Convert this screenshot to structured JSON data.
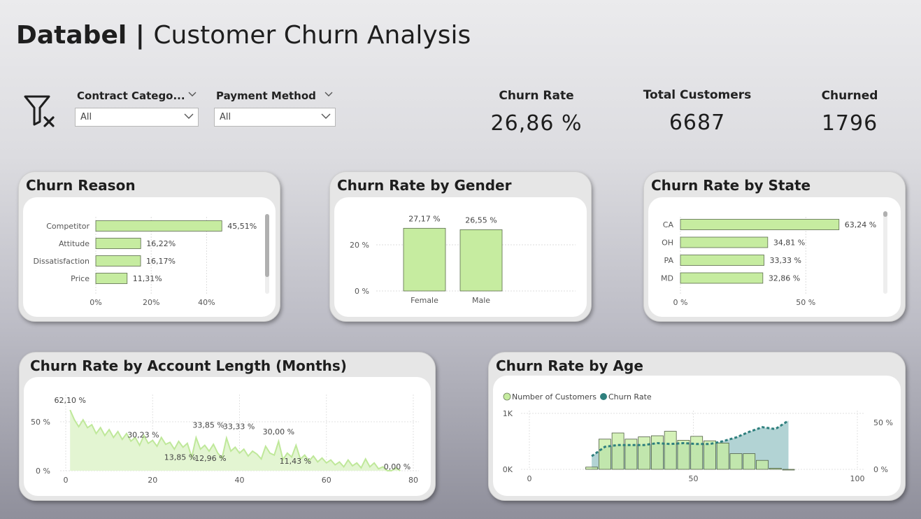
{
  "header": {
    "brand": "Databel | ",
    "title": "Customer Churn Analysis"
  },
  "filters": [
    {
      "label": "Contract Catego...",
      "value": "All"
    },
    {
      "label": "Payment Method",
      "value": "All"
    }
  ],
  "kpis": [
    {
      "label": "Churn Rate",
      "value": "26,86 %"
    },
    {
      "label": "Total Customers",
      "value": "6687"
    },
    {
      "label": "Churned",
      "value": "1796"
    }
  ],
  "colors": {
    "bar": "#c6eca0",
    "bar_stroke": "#5a6b4c",
    "area": "#e3f5d2",
    "line": "#bfe89a",
    "age_bar": "#8fc99a",
    "teal": "#2e7f7d",
    "teal_area": "#a5cbcc"
  },
  "chart_data": [
    {
      "id": "churn_reason",
      "type": "bar",
      "orientation": "horizontal",
      "title": "Churn Reason",
      "categories": [
        "Competitor",
        "Attitude",
        "Dissatisfaction",
        "Price"
      ],
      "values": [
        45.51,
        16.22,
        16.17,
        11.31
      ],
      "labels": [
        "45,51%",
        "16,22%",
        "16,17%",
        "11,31%"
      ],
      "xlim": [
        0,
        50
      ],
      "xticks": [
        "0%",
        "20%",
        "40%"
      ],
      "grid": true
    },
    {
      "id": "gender",
      "type": "bar",
      "title": "Churn Rate by Gender",
      "categories": [
        "Female",
        "Male"
      ],
      "values": [
        27.17,
        26.55
      ],
      "labels": [
        "27,17 %",
        "26,55 %"
      ],
      "ylim": [
        0,
        30
      ],
      "yticks": [
        "0 %",
        "20 %"
      ],
      "grid": true
    },
    {
      "id": "state",
      "type": "bar",
      "orientation": "horizontal",
      "title": "Churn Rate by State",
      "categories": [
        "CA",
        "OH",
        "PA",
        "MD"
      ],
      "values": [
        63.24,
        34.81,
        33.33,
        32.86
      ],
      "labels": [
        "63,24 %",
        "34,81 %",
        "33,33 %",
        "32,86 %"
      ],
      "xlim": [
        0,
        70
      ],
      "xticks": [
        "0 %",
        "50 %"
      ],
      "grid": true
    },
    {
      "id": "account_length",
      "type": "area",
      "title": "Churn Rate by Account Length (Months)",
      "x": [
        1,
        2,
        3,
        4,
        5,
        6,
        7,
        8,
        9,
        10,
        11,
        12,
        13,
        14,
        15,
        16,
        17,
        18,
        19,
        20,
        21,
        22,
        23,
        24,
        25,
        26,
        27,
        28,
        29,
        30,
        31,
        32,
        33,
        34,
        35,
        36,
        37,
        38,
        39,
        40,
        41,
        42,
        43,
        44,
        45,
        46,
        47,
        48,
        49,
        50,
        51,
        52,
        53,
        54,
        55,
        56,
        57,
        58,
        59,
        60,
        61,
        62,
        63,
        64,
        65,
        66,
        67,
        68,
        69,
        70,
        71,
        72,
        73,
        74,
        75,
        76,
        77
      ],
      "y": [
        62.1,
        52,
        45,
        52,
        44,
        47,
        38,
        44,
        36,
        42,
        34,
        40,
        32,
        38,
        30.23,
        34,
        26,
        36,
        28,
        31,
        25,
        34,
        27,
        29,
        22,
        30,
        24,
        28,
        13.85,
        33.85,
        22,
        26,
        20,
        27,
        18,
        12.96,
        33.33,
        20,
        24,
        18,
        22,
        15,
        20,
        17,
        12,
        25,
        18,
        16,
        30,
        11.43,
        18,
        14,
        26,
        12,
        16,
        10,
        15,
        9,
        13,
        8,
        11,
        6,
        9,
        4,
        11,
        5,
        8,
        3,
        12,
        4,
        8,
        2,
        4,
        0,
        0,
        3,
        0
      ],
      "labels": [
        "62,10 %",
        "30,23 %",
        "13,85 %",
        "33,85 %",
        "12,96 %",
        "33,33 %",
        "30,00 %",
        "11,43 %",
        "0,00 %"
      ],
      "xlim": [
        0,
        80
      ],
      "ylim": [
        0,
        70
      ],
      "xticks": [
        "0",
        "20",
        "40",
        "60",
        "80"
      ],
      "yticks": [
        "0 %",
        "50 %"
      ],
      "grid": true
    },
    {
      "id": "age",
      "type": "bar",
      "title": "Churn Rate by Age",
      "series": [
        {
          "name": "Number of Customers",
          "type": "bar",
          "x": [
            19,
            23,
            27,
            31,
            35,
            39,
            43,
            47,
            51,
            55,
            59,
            63,
            67,
            71,
            75,
            79
          ],
          "values": [
            40,
            540,
            650,
            540,
            580,
            600,
            680,
            520,
            590,
            510,
            470,
            280,
            280,
            160,
            20,
            0
          ]
        },
        {
          "name": "Churn Rate",
          "type": "area",
          "x": [
            19,
            23,
            27,
            31,
            35,
            39,
            43,
            47,
            51,
            55,
            59,
            63,
            67,
            71,
            75,
            79
          ],
          "values": [
            14,
            24,
            26,
            26,
            26,
            28,
            27,
            28,
            27,
            27,
            30,
            34,
            40,
            45,
            43,
            52
          ]
        }
      ],
      "xlim": [
        0,
        100
      ],
      "y1lim": [
        0,
        1000
      ],
      "y2lim": [
        0,
        60
      ],
      "xticks": [
        "0",
        "50",
        "100"
      ],
      "y1ticks": [
        "0K",
        "1K"
      ],
      "y2ticks": [
        "0 %",
        "50 %"
      ]
    }
  ]
}
